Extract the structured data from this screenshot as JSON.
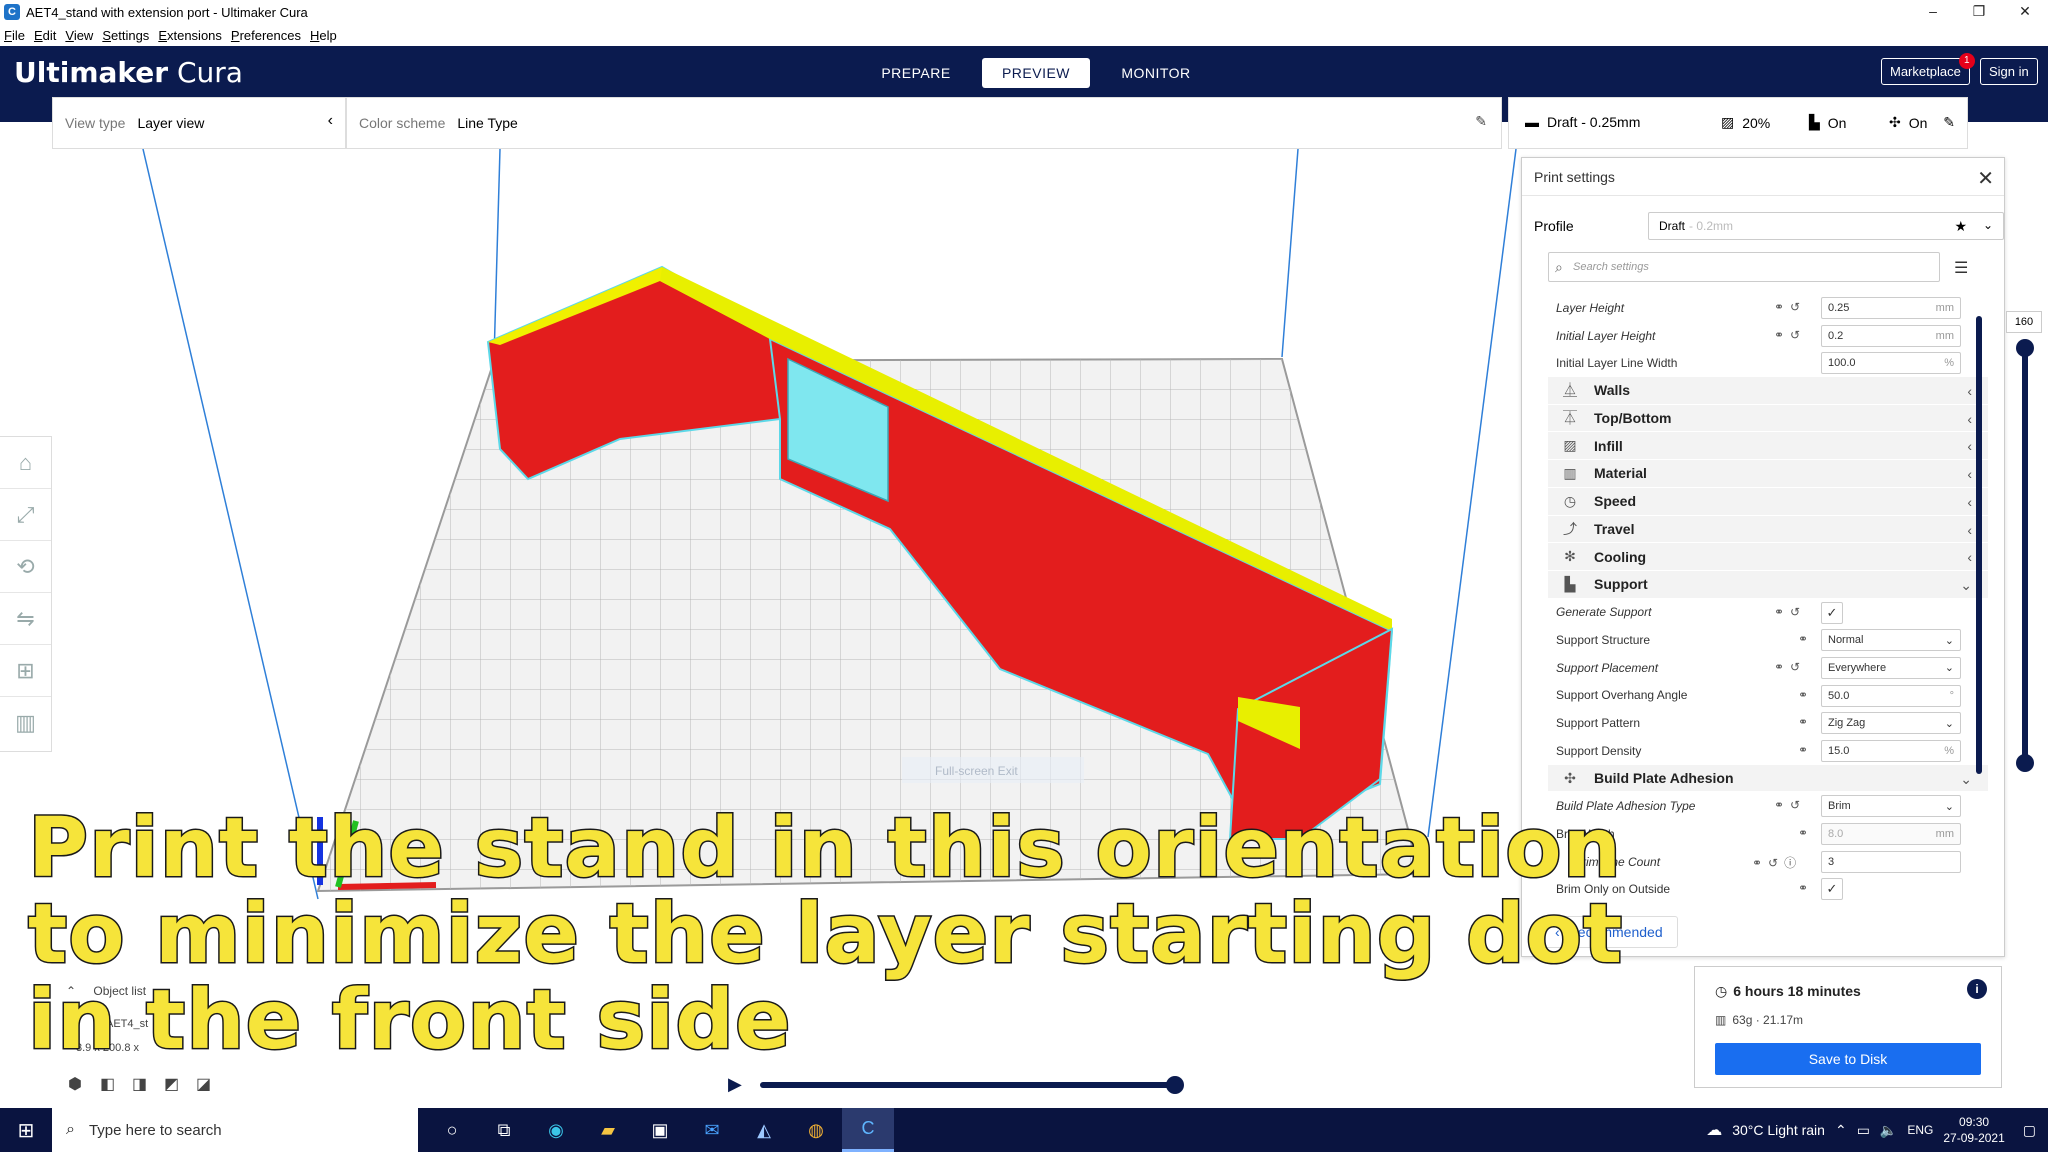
{
  "window": {
    "title": "AET4_stand with extension port - Ultimaker Cura",
    "controls": [
      "–",
      "❐",
      "✕"
    ]
  },
  "menu": [
    "File",
    "Edit",
    "View",
    "Settings",
    "Extensions",
    "Preferences",
    "Help"
  ],
  "header": {
    "logo_bold": "Ultimaker",
    "logo_light": " Cura",
    "tabs": [
      "PREPARE",
      "PREVIEW",
      "MONITOR"
    ],
    "active_tab": "PREVIEW",
    "marketplace": "Marketplace",
    "marketplace_badge": "1",
    "sign_in": "Sign in"
  },
  "view_bar": {
    "label": "View type",
    "value": "Layer view"
  },
  "scheme_bar": {
    "label": "Color scheme",
    "value": "Line Type"
  },
  "settings_bar": {
    "profile": "Draft - 0.25mm",
    "infill": "20%",
    "support": "On",
    "adhesion": "On"
  },
  "panel": {
    "title": "Print settings",
    "profile_label": "Profile",
    "profile_value": "Draft",
    "profile_suffix": " - 0.2mm",
    "search_placeholder": "Search settings",
    "rows": [
      {
        "label": "Layer Height",
        "value": "0.25",
        "unit": "mm"
      },
      {
        "label": "Initial Layer Height",
        "value": "0.2",
        "unit": "mm"
      },
      {
        "label": "Initial Layer Line Width",
        "value": "100.0",
        "unit": "%"
      },
      {
        "label": "Walls"
      },
      {
        "label": "Top/Bottom"
      },
      {
        "label": "Infill"
      },
      {
        "label": "Material"
      },
      {
        "label": "Speed"
      },
      {
        "label": "Travel"
      },
      {
        "label": "Cooling"
      },
      {
        "label": "Support"
      },
      {
        "label": "Generate Support",
        "check": "✓"
      },
      {
        "label": "Support Structure",
        "value": "Normal"
      },
      {
        "label": "Support Placement",
        "value": "Everywhere"
      },
      {
        "label": "Support Overhang Angle",
        "value": "50.0",
        "unit": "°"
      },
      {
        "label": "Support Pattern",
        "value": "Zig Zag"
      },
      {
        "label": "Support Density",
        "value": "15.0",
        "unit": "%"
      },
      {
        "label": "Build Plate Adhesion"
      },
      {
        "label": "Build Plate Adhesion Type",
        "value": "Brim"
      },
      {
        "label": "Brim Width",
        "value": "8.0",
        "unit": "mm"
      },
      {
        "label": "Brim Line Count",
        "value": "3"
      },
      {
        "label": "Brim Only on Outside",
        "check": "✓"
      }
    ],
    "recommended": "Recommended"
  },
  "layer_slider": {
    "top_value": "160"
  },
  "action": {
    "time": "6 hours 18 minutes",
    "material": "63g · 21.17m",
    "save": "Save to Disk",
    "info": "i"
  },
  "object_list": {
    "title": "Object list",
    "item": "AET4_st",
    "dims": "3.9 x 200.8 x"
  },
  "viewport": {
    "fullscreen_hint": "Full-screen Exit"
  },
  "caption": {
    "line1": "Print the stand in this orientation",
    "line2": "to minimize the layer starting dot",
    "line3": "in the front side"
  },
  "taskbar": {
    "search": "Type here to search",
    "temp": "30°C  Light rain",
    "lang": "ENG",
    "time": "09:30",
    "date": "27-09-2021"
  }
}
